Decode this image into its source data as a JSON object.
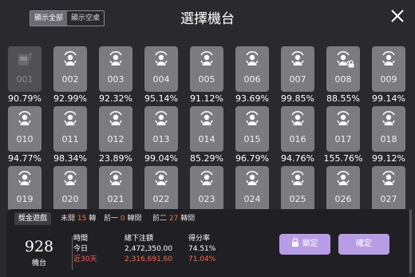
{
  "header": {
    "filter_all": "顯示全部",
    "filter_empty": "顯示空桌",
    "title": "選擇機台"
  },
  "machines": [
    {
      "num": "001",
      "pct": "90.79%",
      "state": "disabled"
    },
    {
      "num": "002",
      "pct": "92.99%",
      "state": "available"
    },
    {
      "num": "003",
      "pct": "92.32%",
      "state": "available"
    },
    {
      "num": "004",
      "pct": "95.14%",
      "state": "available"
    },
    {
      "num": "005",
      "pct": "91.12%",
      "state": "available"
    },
    {
      "num": "006",
      "pct": "93.69%",
      "state": "available"
    },
    {
      "num": "007",
      "pct": "99.85%",
      "state": "available"
    },
    {
      "num": "008",
      "pct": "88.55%",
      "state": "locked"
    },
    {
      "num": "009",
      "pct": "99.14%",
      "state": "available"
    },
    {
      "num": "010",
      "pct": "94.77%",
      "state": "available"
    },
    {
      "num": "011",
      "pct": "98.34%",
      "state": "available"
    },
    {
      "num": "012",
      "pct": "23.89%",
      "state": "available"
    },
    {
      "num": "013",
      "pct": "99.04%",
      "state": "available"
    },
    {
      "num": "014",
      "pct": "85.29%",
      "state": "available"
    },
    {
      "num": "015",
      "pct": "96.79%",
      "state": "available"
    },
    {
      "num": "016",
      "pct": "94.76%",
      "state": "available"
    },
    {
      "num": "017",
      "pct": "155.76%",
      "state": "available"
    },
    {
      "num": "018",
      "pct": "99.12%",
      "state": "available"
    },
    {
      "num": "019",
      "pct": "",
      "state": "available"
    },
    {
      "num": "020",
      "pct": "",
      "state": "available"
    },
    {
      "num": "021",
      "pct": "",
      "state": "available"
    },
    {
      "num": "022",
      "pct": "",
      "state": "available"
    },
    {
      "num": "023",
      "pct": "",
      "state": "available"
    },
    {
      "num": "024",
      "pct": "",
      "state": "available"
    },
    {
      "num": "025",
      "pct": "",
      "state": "available"
    },
    {
      "num": "026",
      "pct": "",
      "state": "available"
    },
    {
      "num": "027",
      "pct": "",
      "state": "available"
    }
  ],
  "panel": {
    "tab": "獎金遊戲",
    "unopened_label": "未開",
    "unopened_value": "15",
    "unopened_unit": "轉",
    "prev1_label": "前一",
    "prev1_value": "0",
    "prev1_unit": "轉開",
    "prev2_label": "前二",
    "prev2_value": "27",
    "prev2_unit": "轉開",
    "machine_number": "928",
    "machine_label": "機台",
    "col_time": "時間",
    "col_total": "總下注額",
    "col_rate": "得分率",
    "row_today": "今日",
    "today_total": "2,472,350.00",
    "today_rate": "74.51%",
    "row_30d": "近30天",
    "d30_total": "2,316,691.60",
    "d30_rate": "71.04%",
    "lock_button": "鎖定",
    "confirm_button": "確定"
  },
  "colors": {
    "background": "#2a2a2e",
    "card": "#7b7b80",
    "accent_button": "#b89de6",
    "highlight": "#f07840"
  }
}
